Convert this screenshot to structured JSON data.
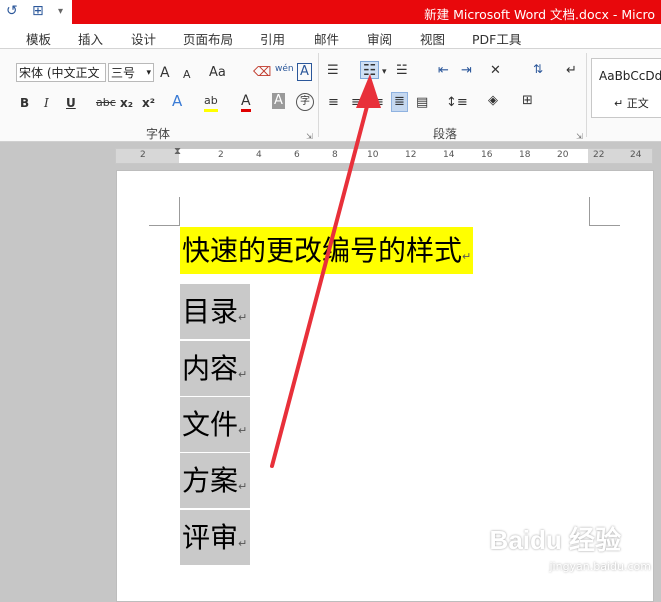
{
  "window": {
    "title": "新建 Microsoft Word 文档.docx - Micro"
  },
  "tabs": [
    {
      "label": "模板"
    },
    {
      "label": "插入"
    },
    {
      "label": "设计"
    },
    {
      "label": "页面布局"
    },
    {
      "label": "引用"
    },
    {
      "label": "邮件"
    },
    {
      "label": "审阅"
    },
    {
      "label": "视图"
    },
    {
      "label": "PDF工具"
    }
  ],
  "font": {
    "name": "宋体 (中文正文",
    "size": "三号",
    "grow": "A",
    "shrink": "A",
    "case": "Aa",
    "pinyin": "wén",
    "clear_format": "A",
    "bold": "B",
    "italic": "I",
    "underline": "U",
    "strike": "abc",
    "sub": "x₂",
    "sup": "x²",
    "text_effect": "A",
    "highlight": "ab",
    "color": "A",
    "shade": "A",
    "encircle": "字"
  },
  "groups": {
    "font_label": "字体",
    "paragraph_label": "段落"
  },
  "styles": {
    "preview": "AaBbCcDd",
    "name": "↵ 正文"
  },
  "ruler": {
    "numbers": [
      "2",
      "2",
      "4",
      "6",
      "8",
      "10",
      "12",
      "14",
      "16",
      "18",
      "20",
      "22",
      "24"
    ]
  },
  "document": {
    "heading": "快速的更改编号的样式",
    "items": [
      "目录",
      "内容",
      "文件",
      "方案",
      "评审"
    ],
    "para_mark": "↵"
  },
  "watermark": {
    "brand": "Baidu 经验",
    "url": "jingyan.baidu.com"
  },
  "colors": {
    "accent_red": "#e8080c",
    "highlight": "#ffff00",
    "list_shade": "#c9c9c9",
    "arrow": "#e8303a"
  }
}
